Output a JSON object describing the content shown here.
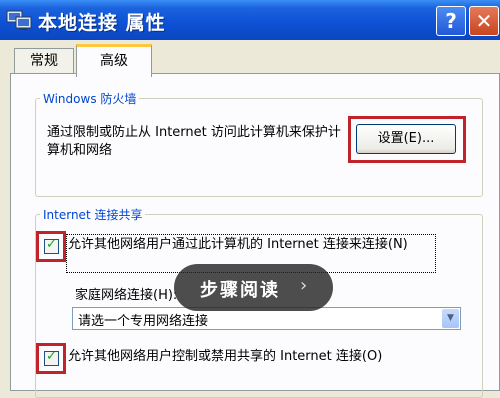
{
  "window": {
    "title": "本地连接 属性",
    "help_glyph": "?",
    "close_glyph": "✕"
  },
  "tabs": [
    {
      "label": "常规",
      "active": false
    },
    {
      "label": "高级",
      "active": true
    }
  ],
  "firewall": {
    "group_title": "Windows 防火墙",
    "description": "通过限制或防止从 Internet 访问此计算机来保护计算机和网络",
    "settings_button": "设置(E)..."
  },
  "ics": {
    "group_title": "Internet 连接共享",
    "allow_connect": {
      "label": "允许其他网络用户通过此计算机的 Internet 连接来连接(N)",
      "checked": true
    },
    "home_network_label": "家庭网络连接(H):",
    "home_network_select": "请选一个专用网络连接",
    "allow_control": {
      "label": "允许其他网络用户控制或禁用共享的 Internet 连接(O)",
      "checked": true
    }
  },
  "overlay": {
    "text": "步骤阅读",
    "arrow": "›"
  },
  "colors": {
    "titlebar": "#0e52d6",
    "highlight_box": "#c0242a",
    "group_title": "#0046d5",
    "active_tab_accent": "#ffc83c",
    "check": "#21a121"
  }
}
